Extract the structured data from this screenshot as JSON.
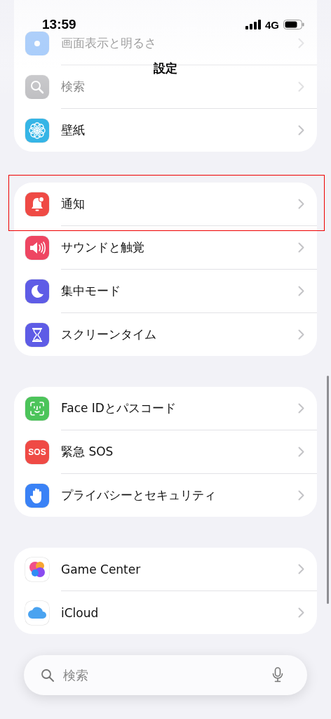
{
  "status_bar": {
    "time": "13:59",
    "network": "4G"
  },
  "title": "設定",
  "groups": [
    {
      "items": [
        {
          "label": "画面表示と明るさ",
          "kind": "display",
          "faded": true,
          "highlighted": false
        },
        {
          "label": "検索",
          "kind": "search",
          "faded": true,
          "highlighted": false
        },
        {
          "label": "壁紙",
          "kind": "flower",
          "faded": false,
          "highlighted": false
        }
      ]
    },
    {
      "items": [
        {
          "label": "通知",
          "kind": "bell",
          "faded": false,
          "highlighted": true
        },
        {
          "label": "サウンドと触覚",
          "kind": "speaker",
          "faded": false,
          "highlighted": false
        },
        {
          "label": "集中モード",
          "kind": "moon",
          "faded": false,
          "highlighted": false
        },
        {
          "label": "スクリーンタイム",
          "kind": "hourglass",
          "faded": false,
          "highlighted": false
        }
      ]
    },
    {
      "items": [
        {
          "label": "Face IDとパスコード",
          "kind": "faceid",
          "faded": false,
          "highlighted": false
        },
        {
          "label": "緊急 SOS",
          "kind": "sos",
          "icon_text": "SOS",
          "faded": false,
          "highlighted": false
        },
        {
          "label": "プライバシーとセキュリティ",
          "kind": "hand",
          "faded": false,
          "highlighted": false
        }
      ]
    },
    {
      "items": [
        {
          "label": "Game Center",
          "kind": "gamecenter",
          "faded": false,
          "highlighted": false
        },
        {
          "label": "iCloud",
          "kind": "cloud",
          "faded": false,
          "highlighted": false
        }
      ]
    }
  ],
  "search": {
    "placeholder": "検索"
  }
}
